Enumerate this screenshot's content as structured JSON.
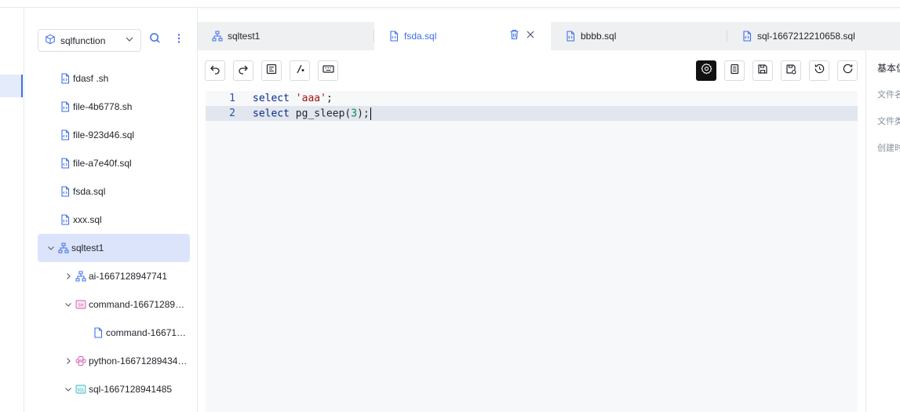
{
  "sidebar": {
    "project": "sqlfunction",
    "tree": [
      {
        "label": "fdasf .sh",
        "icon": "file-code-icon",
        "level": 1
      },
      {
        "label": "file-4b6778.sh",
        "icon": "file-code-icon",
        "level": 1
      },
      {
        "label": "file-923d46.sql",
        "icon": "file-code-icon",
        "level": 1
      },
      {
        "label": "file-a7e40f.sql",
        "icon": "file-code-icon",
        "level": 1
      },
      {
        "label": "fsda.sql",
        "icon": "file-code-icon",
        "level": 1
      },
      {
        "label": "xxx.sql",
        "icon": "file-code-icon",
        "level": 1
      },
      {
        "label": "sqltest1",
        "icon": "workflow-icon",
        "level": 0,
        "expanded": true,
        "selected": true
      },
      {
        "label": "ai-1667128947741",
        "icon": "workflow-icon",
        "level": 1,
        "collapsed": true
      },
      {
        "label": "command-16671289…",
        "icon": "shell-icon",
        "level": 1,
        "expanded": true
      },
      {
        "label": "command-16671…",
        "icon": "file-icon",
        "level": 2
      },
      {
        "label": "python-16671289434…",
        "icon": "python-icon",
        "level": 1,
        "collapsed": true
      },
      {
        "label": "sql-1667128941485",
        "icon": "sql-icon",
        "level": 1,
        "expanded": true
      }
    ]
  },
  "tabs": [
    {
      "label": "sqltest1",
      "icon": "workflow-icon",
      "active": false
    },
    {
      "label": "fsda.sql",
      "icon": "file-code-icon",
      "active": true
    },
    {
      "label": "bbbb.sql",
      "icon": "file-code-icon",
      "active": false
    },
    {
      "label": "sql-1667212210658.sql",
      "icon": "file-code-icon",
      "active": false
    }
  ],
  "toolbar_left": [
    "undo-icon",
    "redo-icon",
    "format-icon",
    "comment-icon",
    "keyboard-icon"
  ],
  "toolbar_right": [
    "settings-icon",
    "copy-icon",
    "save-icon",
    "save-as-icon",
    "history-icon",
    "refresh-icon"
  ],
  "editor": {
    "lines": [
      {
        "no": "1",
        "text": "select 'aaa';"
      },
      {
        "no": "2",
        "text": "select pg_sleep(3);"
      }
    ],
    "current_line": 2
  },
  "right_panel": {
    "title": "基本信",
    "items": [
      "文件名",
      "文件类",
      "创建时"
    ]
  },
  "colors": {
    "accent": "#3d6ee6",
    "selected_bg": "#dbe4fb"
  }
}
